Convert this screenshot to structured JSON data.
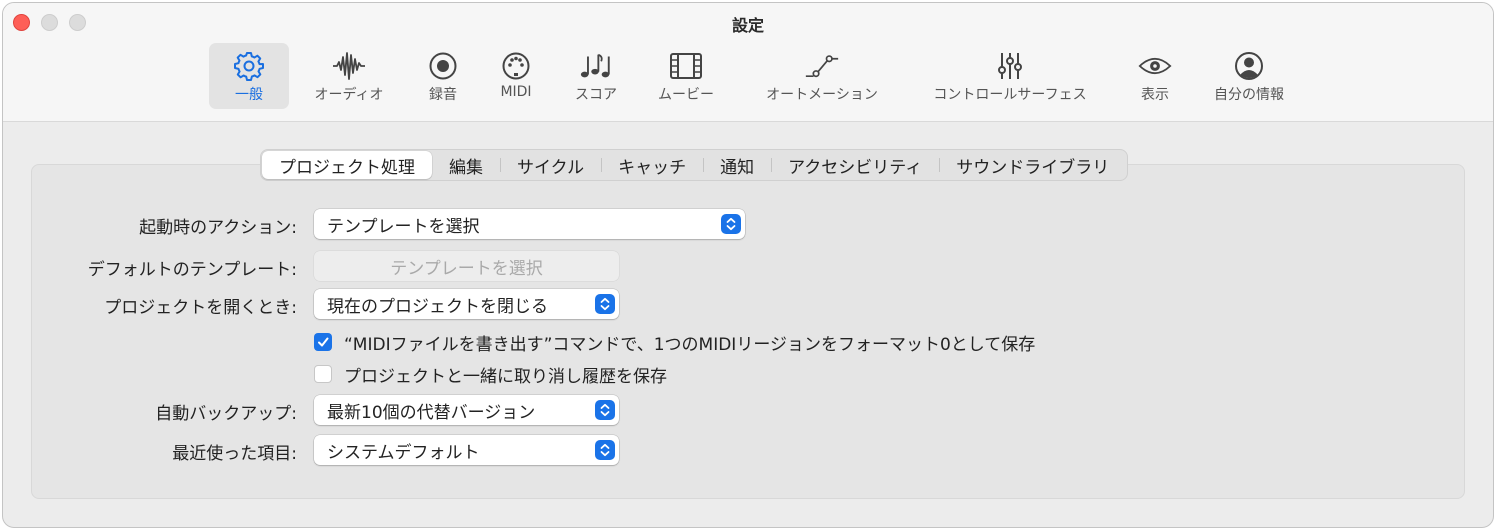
{
  "window": {
    "title": "設定"
  },
  "toolbar": {
    "items": [
      {
        "label": "一般",
        "icon": "gear-icon",
        "active": true
      },
      {
        "label": "オーディオ",
        "icon": "waveform-icon"
      },
      {
        "label": "録音",
        "icon": "record-icon"
      },
      {
        "label": "MIDI",
        "icon": "midi-connector-icon"
      },
      {
        "label": "スコア",
        "icon": "music-notes-icon"
      },
      {
        "label": "ムービー",
        "icon": "film-icon"
      },
      {
        "label": "オートメーション",
        "icon": "automation-curve-icon"
      },
      {
        "label": "コントロールサーフェス",
        "icon": "sliders-icon"
      },
      {
        "label": "表示",
        "icon": "eye-icon"
      },
      {
        "label": "自分の情報",
        "icon": "person-circle-icon"
      }
    ]
  },
  "tabs": {
    "items": [
      {
        "label": "プロジェクト処理",
        "active": true
      },
      {
        "label": "編集"
      },
      {
        "label": "サイクル"
      },
      {
        "label": "キャッチ"
      },
      {
        "label": "通知"
      },
      {
        "label": "アクセシビリティ"
      },
      {
        "label": "サウンドライブラリ"
      }
    ]
  },
  "settings": {
    "startup_action": {
      "label": "起動時のアクション:",
      "value": "テンプレートを選択"
    },
    "default_template": {
      "label": "デフォルトのテンプレート:",
      "button": "テンプレートを選択"
    },
    "open_project": {
      "label": "プロジェクトを開くとき:",
      "value": "現在のプロジェクトを閉じる"
    },
    "midi_export": {
      "label": "“MIDIファイルを書き出す”コマンドで、1つのMIDIリージョンをフォーマット0として保存",
      "checked": true
    },
    "save_undo": {
      "label": "プロジェクトと一緒に取り消し履歴を保存",
      "checked": false
    },
    "auto_backup": {
      "label": "自動バックアップ:",
      "value": "最新10個の代替バージョン"
    },
    "recent_items": {
      "label": "最近使った項目:",
      "value": "システムデフォルト"
    }
  },
  "colors": {
    "accent": "#1a73e8",
    "active_label": "#1a6fe0",
    "close": "#fe5f57"
  }
}
